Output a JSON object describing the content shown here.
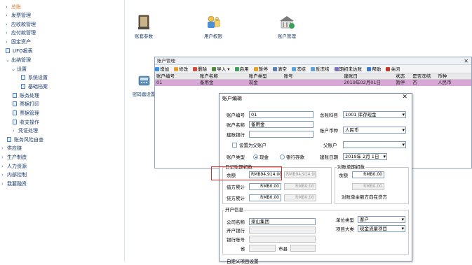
{
  "sidebar": {
    "items": [
      {
        "label": "总账",
        "chev": "›"
      },
      {
        "label": "发票管理",
        "chev": "›"
      },
      {
        "label": "应收款管理",
        "chev": "›"
      },
      {
        "label": "应付款管理",
        "chev": "›"
      },
      {
        "label": "固定资产",
        "chev": "›"
      },
      {
        "label": "UFO报表"
      },
      {
        "label": "出纳管理",
        "chev": "⌄"
      },
      {
        "label": "设置",
        "chev": "⌄"
      },
      {
        "label": "系统设置"
      },
      {
        "label": "基础档案"
      },
      {
        "label": "账务处理"
      },
      {
        "label": "票据打印"
      },
      {
        "label": "票据管理"
      },
      {
        "label": "收支操作"
      },
      {
        "label": "凭证处理",
        "chev": "›"
      },
      {
        "label": "账务风险自查"
      },
      {
        "label": "供应链",
        "chev": "›"
      },
      {
        "label": "生产制造",
        "chev": "›"
      },
      {
        "label": "人力资源",
        "chev": "›"
      },
      {
        "label": "内部控制",
        "chev": "›"
      },
      {
        "label": "我要融资",
        "chev": "›"
      }
    ]
  },
  "desktop": {
    "icons": [
      {
        "label": "账套参数",
        "icon": "ledger-book-icon"
      },
      {
        "label": "用户权限",
        "icon": "user-permission-icon"
      },
      {
        "label": "账户管理",
        "icon": "account-management-icon"
      },
      {
        "label": "密码器设置",
        "icon": "password-device-icon"
      }
    ]
  },
  "account_window": {
    "title": "账户管理",
    "close": "✕",
    "toolbar": [
      {
        "label": "增加",
        "color": "#3a8ee6"
      },
      {
        "label": "修改",
        "color": "#e2a13a"
      },
      {
        "label": "删除",
        "color": "#d84a3a"
      },
      {
        "label": "导入",
        "color": "#4f8a3d"
      },
      {
        "label": "启用",
        "color": "#3aa15c"
      },
      {
        "label": "暂停",
        "color": "#e0a42b"
      },
      {
        "label": "清空",
        "color": "#5a7fb5"
      },
      {
        "label": "冻结",
        "color": "#5ba4d9"
      },
      {
        "label": "反冻结",
        "color": "#5ba4d9"
      },
      {
        "label": "期初未达账",
        "color": "#7a6fc0"
      },
      {
        "label": "帮助",
        "color": "#3a7bd5"
      },
      {
        "label": "关闭",
        "color": "#c0392b"
      }
    ],
    "columns": [
      "账户编号",
      "账户名称",
      "账户类型",
      "账号",
      "建账日",
      "状态",
      "是否冻结",
      "币种"
    ],
    "rows": [
      [
        "01",
        "备用金",
        "现金",
        "",
        "2019年02月01日",
        "暂停",
        "否",
        "人民币"
      ]
    ]
  },
  "edit_dialog": {
    "title": "账户编辑",
    "close": "✕",
    "account_no_label": "账户编号",
    "account_no": "01",
    "account_name_label": "账户名称",
    "account_name": "备用金",
    "bank_label": "建账银行",
    "bank": "",
    "parent_checkbox_label": "设置为父账户",
    "account_type_label": "账户类型",
    "type_cash": "现金",
    "type_bank": "银行存款",
    "gl_subject_label": "总账科目",
    "gl_subject": "1001 库存现金",
    "currency_label": "账户币种",
    "currency": "人民币",
    "parent_account_label": "父账户",
    "parent_account": "",
    "open_date_label": "建账日期",
    "open_date": "2019年 2月 1日",
    "journal_group_title": "日记账期初数",
    "balance_label": "余额",
    "balance_value": "RMB94,914.00",
    "balance_value2": "RMB94,914.00",
    "debit_label": "借方累计",
    "debit_value": "RMB0.00",
    "debit_value2": "RMB0.00",
    "credit_label": "贷方累计",
    "credit_value": "RMB0.00",
    "credit_value2": "RMB0.00",
    "statement_group_title": "对账单期初数",
    "stmt_balance_label": "余额",
    "stmt_balance_value": "RMB0.00",
    "stmt_value2": "RMB0.00",
    "stmt_note": "对账单余额方向在贷方",
    "open_info_title": "开户信息",
    "company_label": "公司名称",
    "company": "梁山集团",
    "open_bank_label": "开户银行",
    "bank_acct_label": "银行账号",
    "province_label": "省",
    "city_label": "市县",
    "unit_type_label": "单位类型",
    "unit_type": "客户",
    "project_label": "项目大类",
    "project": "现金流量项目",
    "custom_title": "自定义项目设置"
  },
  "colors": {
    "highlight": "#e5231b",
    "selected_row": "#d9a7d6",
    "accent": "#e0752a"
  }
}
